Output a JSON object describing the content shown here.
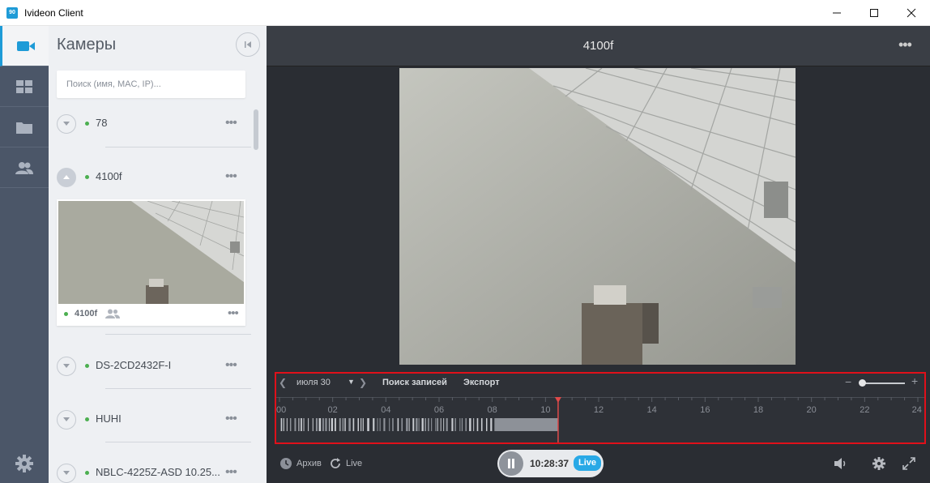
{
  "window": {
    "title": "Ivideon Client",
    "logo_text": "90"
  },
  "rail": {
    "items": [
      {
        "icon": "video-camera-icon",
        "active": true
      },
      {
        "icon": "grid-icon",
        "active": false
      },
      {
        "icon": "folder-icon",
        "active": false
      },
      {
        "icon": "users-icon",
        "active": false
      }
    ],
    "bottom_icon": "gear-icon"
  },
  "sidebar": {
    "title": "Камеры",
    "search_placeholder": "Поиск (имя, MAC, IP)...",
    "cameras": [
      {
        "name": "78",
        "status": "online",
        "expanded": false
      },
      {
        "name": "4100f",
        "status": "online",
        "expanded": true
      },
      {
        "name": "DS-2CD2432F-I",
        "status": "online",
        "expanded": false
      },
      {
        "name": "HUHI",
        "status": "online",
        "expanded": false
      },
      {
        "name": "NBLC-4225Z-ASD 10.25...",
        "status": "online",
        "expanded": false
      }
    ],
    "thumbnail": {
      "name": "4100f",
      "status": "online"
    },
    "more_label": "•••"
  },
  "main": {
    "title": "4100f",
    "more_label": "•••"
  },
  "timeline": {
    "date": "июля 30",
    "search_records": "Поиск записей",
    "export": "Экспорт",
    "hour_labels": [
      "00",
      "02",
      "04",
      "06",
      "08",
      "10",
      "12",
      "14",
      "16",
      "18",
      "20",
      "22",
      "24"
    ],
    "zoom_level": 0.05,
    "playhead_time": "10:28:37"
  },
  "controls": {
    "archive": "Архив",
    "live": "Live",
    "time": "10:28:37",
    "live_badge": "Live"
  },
  "colors": {
    "accent": "#1e9bd7",
    "online": "#4caf50",
    "highlight_border": "#e0101a",
    "live_badge": "#29a9e6",
    "playhead": "#e04a4a"
  }
}
